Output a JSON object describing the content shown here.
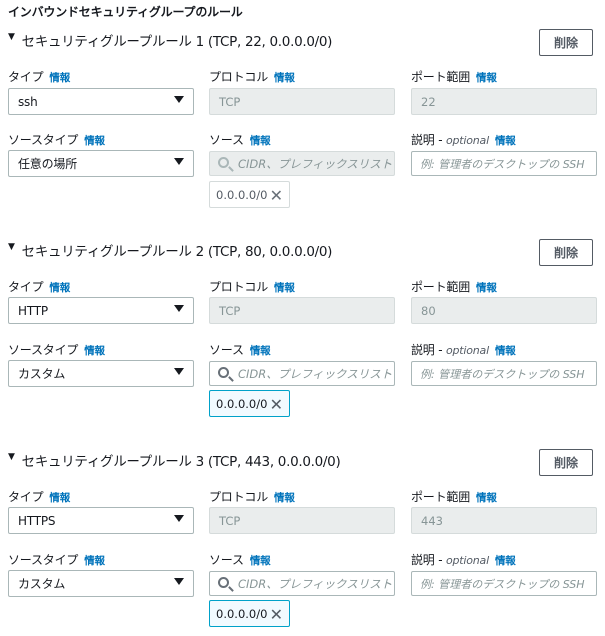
{
  "page": {
    "title": "インバウンドセキュリティグループのルール"
  },
  "labels": {
    "type": "タイプ",
    "protocol": "プロトコル",
    "port_range": "ポート範囲",
    "source_type": "ソースタイプ",
    "source": "ソース",
    "description": "説明 - ",
    "optional": "optional",
    "info": "情報",
    "delete": "削除",
    "source_placeholder": "CIDR、プレフィックスリスト",
    "description_placeholder": "例: 管理者のデスクトップの SSH"
  },
  "rules": [
    {
      "title": "セキュリティグループルール 1 (TCP, 22, 0.0.0.0/0)",
      "type": "ssh",
      "protocol": "TCP",
      "port_range": "22",
      "source_type": "任意の場所",
      "source_token": "0.0.0.0/0",
      "source_disabled": true
    },
    {
      "title": "セキュリティグループルール 2 (TCP, 80, 0.0.0.0/0)",
      "type": "HTTP",
      "protocol": "TCP",
      "port_range": "80",
      "source_type": "カスタム",
      "source_token": "0.0.0.0/0",
      "source_disabled": false
    },
    {
      "title": "セキュリティグループルール 3 (TCP, 443, 0.0.0.0/0)",
      "type": "HTTPS",
      "protocol": "TCP",
      "port_range": "443",
      "source_type": "カスタム",
      "source_token": "0.0.0.0/0",
      "source_disabled": false
    }
  ],
  "icons": {
    "caret": "caret-down-icon",
    "dropdown": "triangle-down-icon",
    "search": "search-icon",
    "remove": "close-icon"
  },
  "colors": {
    "info_link": "#0073bb",
    "token_border": "#00a1c9",
    "disabled_bg": "#eaeded"
  }
}
